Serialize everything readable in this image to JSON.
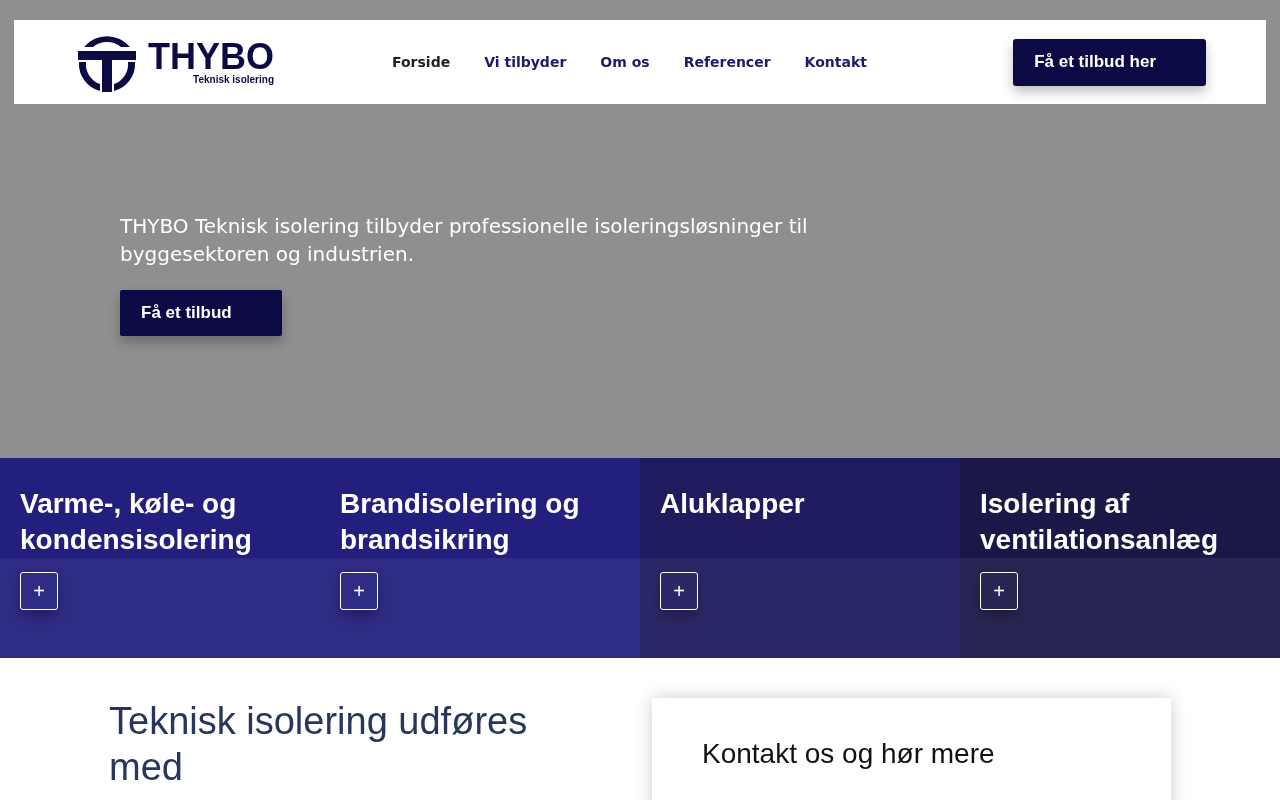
{
  "header": {
    "logo": {
      "name": "THYBO",
      "tagline": "Teknisk isolering"
    },
    "nav": [
      {
        "label": "Forside",
        "selected": true
      },
      {
        "label": "Vi tilbyder",
        "selected": false
      },
      {
        "label": "Om os",
        "selected": false
      },
      {
        "label": "Referencer",
        "selected": false
      },
      {
        "label": "Kontakt",
        "selected": false
      }
    ],
    "cta": "Få et tilbud her"
  },
  "hero": {
    "text": "THYBO Teknisk isolering tilbyder professionelle isoleringsløsninger til byggesektoren og industrien.",
    "button": "Få et tilbud"
  },
  "services": [
    {
      "title": "Varme-, køle- og kondensisolering",
      "button": "+",
      "color": "#221f7e"
    },
    {
      "title": "Brandisolering og brandsikring",
      "button": "+",
      "color": "#221f7e"
    },
    {
      "title": "Aluklapper",
      "button": "+",
      "color": "#1e1b5e"
    },
    {
      "title": "Isolering af ventilationsanlæg",
      "button": "+",
      "color": "#1b1848"
    }
  ],
  "intro": {
    "heading": "Teknisk isolering udføres med",
    "contact_title": "Kontakt os og hør mere"
  }
}
